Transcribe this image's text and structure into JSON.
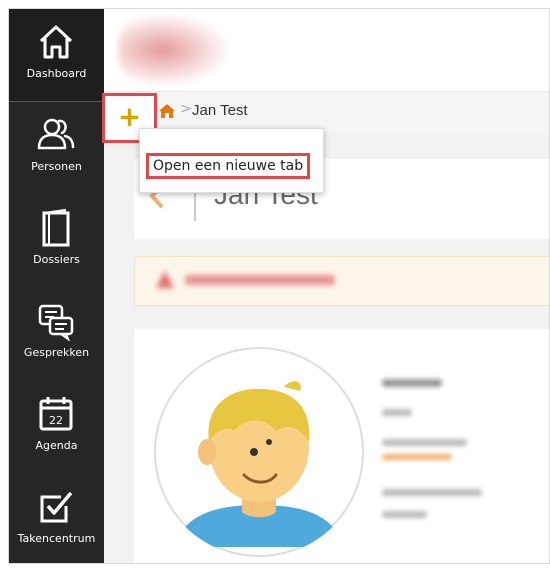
{
  "sidebar": {
    "items": [
      {
        "label": "Dashboard",
        "icon": "home-icon"
      },
      {
        "label": "Personen",
        "icon": "people-icon"
      },
      {
        "label": "Dossiers",
        "icon": "folder-icon"
      },
      {
        "label": "Gesprekken",
        "icon": "chat-icon"
      },
      {
        "label": "Agenda",
        "icon": "calendar-icon",
        "calendar_day": "22"
      },
      {
        "label": "Takencentrum",
        "icon": "checkbox-icon"
      }
    ]
  },
  "toolbar": {
    "plus_label": "+"
  },
  "breadcrumb": {
    "separator": ">",
    "current": "Jan Test"
  },
  "popup": {
    "open_new_tab": "Open een nieuwe tab"
  },
  "page": {
    "title": "Jan Test"
  },
  "colors": {
    "sidebar_bg": "#262626",
    "highlight": "#e4474b",
    "plus": "#e0a000",
    "home": "#e07a10"
  }
}
